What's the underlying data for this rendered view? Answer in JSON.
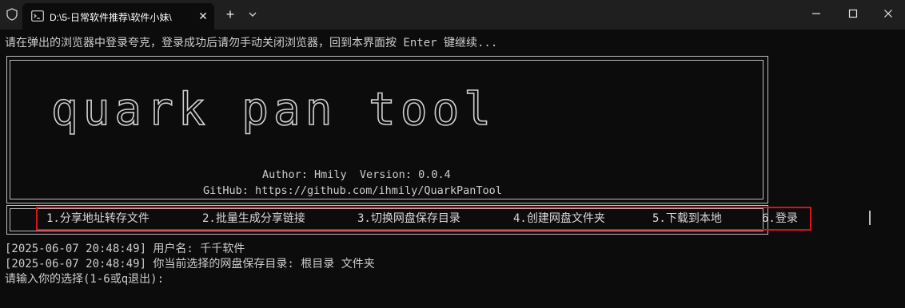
{
  "window": {
    "tab_title": "D:\\5-日常软件推荐\\软件小妹\\",
    "tab_close": "✕",
    "new_tab": "+"
  },
  "terminal": {
    "prompt_line": "请在弹出的浏览器中登录夸克，登录成功后请勿手动关闭浏览器，回到本界面按 Enter 键继续...",
    "ascii_banner": "quark pan tool",
    "author_line": "Author: Hmily  Version: 0.0.4",
    "github_line": "GitHub: https://github.com/ihmily/QuarkPanTool",
    "menu": [
      "1.分享地址转存文件",
      "2.批量生成分享链接",
      "3.切换网盘保存目录",
      "4.创建网盘文件夹",
      "5.下载到本地",
      "6.登录"
    ],
    "log_lines": [
      "[2025-06-07 20:48:49] 用户名: 千千软件",
      "[2025-06-07 20:48:49] 你当前选择的网盘保存目录: 根目录 文件夹"
    ],
    "input_prompt": "请输入你的选择(1-6或q退出):"
  },
  "colors": {
    "background": "#0c0c0c",
    "titlebar": "#1f1f1f",
    "text": "#cccccc",
    "highlight_border": "#e0101a"
  },
  "icons": {
    "shield": "shield-icon",
    "tab": "terminal-icon",
    "dropdown": "chevron-down-icon",
    "minimize": "minimize-icon",
    "maximize": "maximize-icon",
    "close": "close-icon"
  }
}
